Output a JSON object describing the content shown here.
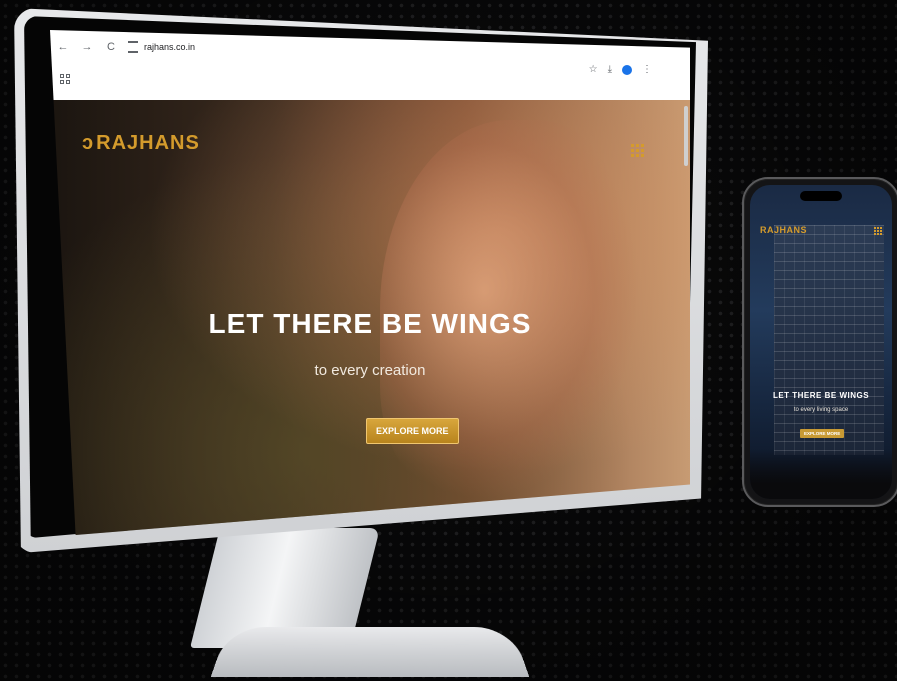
{
  "browser": {
    "url": "rajhans.co.in",
    "back_label": "←",
    "forward_label": "→",
    "reload_label": "C",
    "star_label": "☆",
    "download_label": "⤓",
    "menu_label": "⋮"
  },
  "site": {
    "logo_text": "RAJHANS",
    "logo_mark": "ↄ",
    "headline": "LET THERE BE WINGS",
    "subheadline": "to every creation",
    "cta_label": "EXPLORE MORE"
  },
  "mobile": {
    "logo_text": "RAJHANS",
    "headline": "LET THERE BE WINGS",
    "subheadline": "to every living space",
    "cta_label": "EXPLORE MORE"
  },
  "colors": {
    "brand_gold": "#d49b2c",
    "background": "#0b0b0c"
  },
  "icons": [
    "back-icon",
    "forward-icon",
    "reload-icon",
    "site-settings-icon",
    "star-icon",
    "download-icon",
    "profile-icon",
    "more-icon",
    "apps-icon",
    "menu-grid-icon"
  ]
}
